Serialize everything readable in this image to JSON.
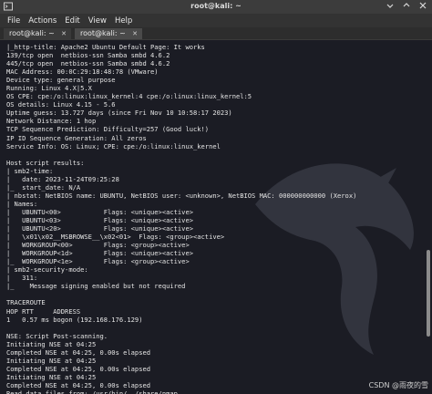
{
  "window": {
    "title": "root@kali: ~"
  },
  "menu": [
    "File",
    "Actions",
    "Edit",
    "View",
    "Help"
  ],
  "tabs": [
    {
      "label": "root@kali: ~"
    },
    {
      "label": "root@kali: ~"
    }
  ],
  "icons": {
    "window_menu": "terminal-icon",
    "minimize": "minimize-icon",
    "maximize": "maximize-icon",
    "close": "close-icon",
    "tab_close": "close-icon"
  },
  "terminal_lines": [
    "|_http-title: Apache2 Ubuntu Default Page: It works",
    "139/tcp open  netbios-ssn Samba smbd 4.6.2",
    "445/tcp open  netbios-ssn Samba smbd 4.6.2",
    "MAC Address: 00:0C:29:18:48:78 (VMware)",
    "Device type: general purpose",
    "Running: Linux 4.X|5.X",
    "OS CPE: cpe:/o:linux:linux_kernel:4 cpe:/o:linux:linux_kernel:5",
    "OS details: Linux 4.15 - 5.6",
    "Uptime guess: 13.727 days (since Fri Nov 10 10:58:17 2023)",
    "Network Distance: 1 hop",
    "TCP Sequence Prediction: Difficulty=257 (Good luck!)",
    "IP ID Sequence Generation: All zeros",
    "Service Info: OS: Linux; CPE: cpe:/o:linux:linux_kernel",
    "",
    "Host script results:",
    "| smb2-time:",
    "|   date: 2023-11-24T09:25:28",
    "|_  start_date: N/A",
    "| nbstat: NetBIOS name: UBUNTU, NetBIOS user: <unknown>, NetBIOS MAC: 000000000000 (Xerox)",
    "| Names:",
    "|   UBUNTU<00>           Flags: <unique><active>",
    "|   UBUNTU<03>           Flags: <unique><active>",
    "|   UBUNTU<20>           Flags: <unique><active>",
    "|   \\x01\\x02__MSBROWSE__\\x02<01>  Flags: <group><active>",
    "|   WORKGROUP<00>        Flags: <group><active>",
    "|   WORKGROUP<1d>        Flags: <unique><active>",
    "|_  WORKGROUP<1e>        Flags: <group><active>",
    "| smb2-security-mode:",
    "|   311:",
    "|_    Message signing enabled but not required",
    "",
    "TRACEROUTE",
    "HOP RTT     ADDRESS",
    "1   0.57 ms bogon (192.168.176.129)",
    "",
    "NSE: Script Post-scanning.",
    "Initiating NSE at 04:25",
    "Completed NSE at 04:25, 0.00s elapsed",
    "Initiating NSE at 04:25",
    "Completed NSE at 04:25, 0.00s elapsed",
    "Initiating NSE at 04:25",
    "Completed NSE at 04:25, 0.00s elapsed",
    "Read data files from: /usr/bin/../share/nmap"
  ],
  "watermark": "CSDN @雨夜的雪"
}
